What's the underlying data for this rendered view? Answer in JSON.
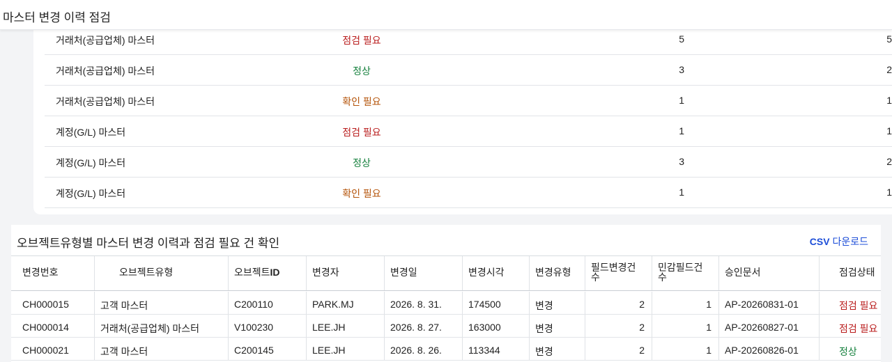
{
  "page": {
    "title": "마스터 변경 이력 점검"
  },
  "summary": {
    "rows": [
      {
        "type": "거래처(공급업체) 마스터",
        "status": "점검 필요",
        "status_color": "#b91c1c",
        "n1": "5",
        "n2": "5"
      },
      {
        "type": "거래처(공급업체) 마스터",
        "status": "정상",
        "status_color": "#15803d",
        "n1": "3",
        "n2": "2"
      },
      {
        "type": "거래처(공급업체) 마스터",
        "status": "확인 필요",
        "status_color": "#b45309",
        "n1": "1",
        "n2": "1"
      },
      {
        "type": "계정(G/L) 마스터",
        "status": "점검 필요",
        "status_color": "#b91c1c",
        "n1": "1",
        "n2": "1"
      },
      {
        "type": "계정(G/L) 마스터",
        "status": "정상",
        "status_color": "#15803d",
        "n1": "3",
        "n2": "2"
      },
      {
        "type": "계정(G/L) 마스터",
        "status": "확인 필요",
        "status_color": "#b45309",
        "n1": "1",
        "n2": "1"
      }
    ]
  },
  "detail": {
    "title": "오브젝트유형별 마스터 변경 이력과 점검 필요 건 확인",
    "csv_prefix": "CSV",
    "csv_suffix": " 다운로드",
    "columns": {
      "change_no": "변경번호",
      "object_type": "오브젝트유형",
      "object_id_prefix": "오브젝트",
      "object_id_suffix": "ID",
      "changer": "변경자",
      "change_date": "변경일",
      "change_time": "변경시각",
      "change_kind": "변경유형",
      "field_changes_1": "필드변경건",
      "field_changes_2": "수",
      "sensitive_1": "민감필드건",
      "sensitive_2": "수",
      "approval_doc": "승인문서",
      "check_status": "점검상태"
    },
    "rows": [
      {
        "change_no": "CH000015",
        "object_type": "고객 마스터",
        "object_id": "C200110",
        "changer": "PARK.MJ",
        "change_date": "2026. 8. 31.",
        "change_time": "174500",
        "change_kind": "변경",
        "field_changes": "2",
        "sensitive": "1",
        "approval_doc": "AP-20260831-01",
        "check_status": "점검 필요",
        "status_color": "#b91c1c"
      },
      {
        "change_no": "CH000014",
        "object_type": "거래처(공급업체) 마스터",
        "object_id": "V100230",
        "changer": "LEE.JH",
        "change_date": "2026. 8. 27.",
        "change_time": "163000",
        "change_kind": "변경",
        "field_changes": "2",
        "sensitive": "1",
        "approval_doc": "AP-20260827-01",
        "check_status": "점검 필요",
        "status_color": "#b91c1c"
      },
      {
        "change_no": "CH000021",
        "object_type": "고객 마스터",
        "object_id": "C200145",
        "changer": "LEE.JH",
        "change_date": "2026. 8. 26.",
        "change_time": "113344",
        "change_kind": "변경",
        "field_changes": "2",
        "sensitive": "1",
        "approval_doc": "AP-20260826-01",
        "check_status": "정상",
        "status_color": "#15803d"
      }
    ]
  }
}
